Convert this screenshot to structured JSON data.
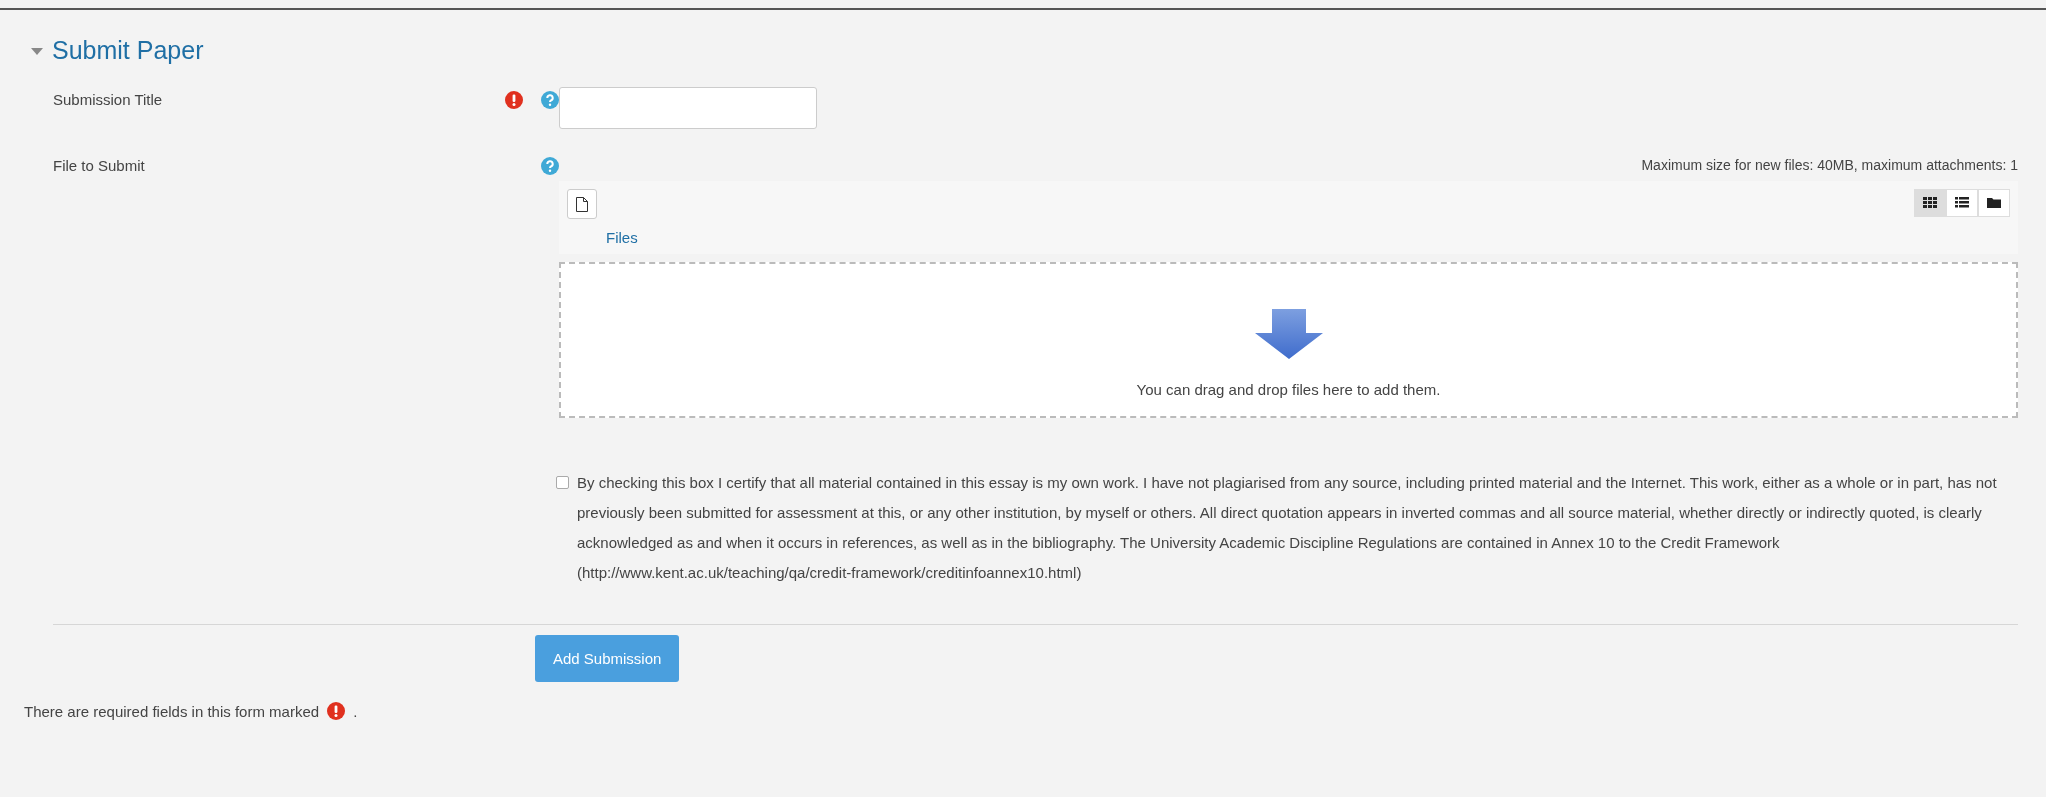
{
  "section": {
    "title": "Submit Paper",
    "expanded": true
  },
  "fields": [
    {
      "kind": "text",
      "label": "Submission Title",
      "required": true
    },
    {
      "kind": "file",
      "label": "File to Submit",
      "required": false,
      "limits": "Maximum size for new files: 40MB, maximum attachments: 1",
      "folder": "Files",
      "views": [
        {
          "kind": "grid",
          "selected": true
        },
        {
          "kind": "list",
          "selected": false
        },
        {
          "kind": "tree",
          "selected": false
        }
      ],
      "drop_hint": "You can drag and drop files here to add them."
    }
  ],
  "declaration": {
    "checked": false,
    "text": "By checking this box I certify that all material contained in this essay is my own work. I have not plagiarised from any source, including printed material and the Internet. This work, either as a whole or in part, has not previously been submitted for assessment at this, or any other institution, by myself or others. All direct quotation appears in inverted commas and all source material, whether directly or indirectly quoted, is clearly acknowledged as and when it occurs in references, as well as in the bibliography. The University Academic Discipline Regulations are contained in Annex 10 to the Credit Framework (http://www.kent.ac.uk/teaching/qa/credit-framework/creditinfoannex10.html)"
  },
  "submit_button": "Add Submission",
  "footer": {
    "text": "There are required fields in this form marked",
    "suffix": "."
  }
}
